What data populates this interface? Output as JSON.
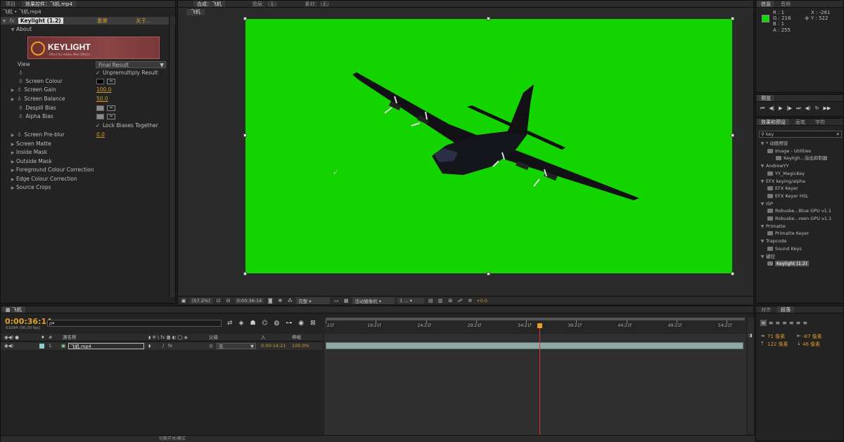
{
  "app": {
    "top_tabs": [
      "项目",
      "效果控件：飞机.mp4",
      "合成：飞机",
      "图层：（无）",
      "素材：（无）"
    ]
  },
  "effect_controls": {
    "breadcrumb": "飞机 • 飞机.mp4",
    "fx_label": "fx",
    "effect_name": "Keylight (1.2)",
    "reset": "重置",
    "about_link": "关于...",
    "about": "About",
    "logo_text": "KEYLIGHT",
    "logo_sub": "Effect for Adobe After Effects",
    "view_label": "View",
    "view_value": "Final Result",
    "unpremultiply": "Unpremultiply Result",
    "screen_colour": "Screen Colour",
    "screen_gain": "Screen Gain",
    "screen_gain_val": "100.0",
    "screen_balance": "Screen Balance",
    "screen_balance_val": "50.0",
    "despill_bias": "Despill Bias",
    "alpha_bias": "Alpha Bias",
    "lock_biases": "Lock Biases Together",
    "screen_preblur": "Screen Pre-blur",
    "screen_preblur_val": "0.0",
    "groups": [
      "Screen Matte",
      "Inside Mask",
      "Outside Mask",
      "Foreground Colour Correction",
      "Edge Colour Correction",
      "Source Crops"
    ]
  },
  "composition": {
    "tab": "飞机",
    "zoom": "(57.2%)",
    "timecode": "0:00:36:14",
    "quality": "完整",
    "camera": "活动摄像机",
    "views": "1 ...",
    "exposure": "+0.0"
  },
  "info": {
    "tabs": [
      "信息",
      "音频"
    ],
    "r": "R : 1",
    "g": "G : 216",
    "b": "B : 1",
    "a": "A : 255",
    "x": "X : -261",
    "y": "Y : 522",
    "swatch": "#12d801"
  },
  "preview": {
    "tab": "预览"
  },
  "effects_presets": {
    "tabs": [
      "效果和预设",
      "画笔",
      "字符"
    ],
    "search": "key",
    "items": [
      {
        "label": "* 动画预设",
        "level": 0,
        "type": "folder"
      },
      {
        "label": "Image - Utilities",
        "level": 1,
        "type": "folder"
      },
      {
        "label": "Keyligh...溢出抑制器",
        "level": 2,
        "type": "preset"
      },
      {
        "label": "AndrewYY",
        "level": 0,
        "type": "cat"
      },
      {
        "label": "YY_MagicKey",
        "level": 1,
        "type": "plugin"
      },
      {
        "label": "EFX keying/alpha",
        "level": 0,
        "type": "cat"
      },
      {
        "label": "EFX Keyer",
        "level": 1,
        "type": "plugin"
      },
      {
        "label": "EFX Keyer HSL",
        "level": 1,
        "type": "plugin"
      },
      {
        "label": "ISP",
        "level": 0,
        "type": "cat"
      },
      {
        "label": "Robuske...Blue GPU v1.1",
        "level": 1,
        "type": "plugin"
      },
      {
        "label": "Robuske...reen GPU v1.1",
        "level": 1,
        "type": "plugin"
      },
      {
        "label": "Primatte",
        "level": 0,
        "type": "cat"
      },
      {
        "label": "Primatte Keyer",
        "level": 1,
        "type": "plugin"
      },
      {
        "label": "Trapcode",
        "level": 0,
        "type": "cat"
      },
      {
        "label": "Sound Keys",
        "level": 1,
        "type": "plugin"
      },
      {
        "label": "键控",
        "level": 0,
        "type": "cat"
      },
      {
        "label": "Keylight (1.2)",
        "level": 1,
        "type": "plugin",
        "selected": true
      }
    ]
  },
  "paragraph": {
    "tabs": [
      "对齐",
      "段落"
    ],
    "v1": "71 像素",
    "v2": "-87 像素",
    "v3": "122 像素",
    "v4": "46 像素"
  },
  "timeline": {
    "tab": "飞机",
    "timecode": "0:00:36:14",
    "frames": "01094 (30.00 fps)",
    "search_placeholder": "ρ▾",
    "col_name": "源名称",
    "col_parent": "父级",
    "col_in": "入",
    "col_stretch": "伸缩",
    "layer": {
      "num": "1",
      "name": "飞机.mp4",
      "fx": "fx",
      "parent": "无",
      "in": "0:00:14:21",
      "stretch": "100.0%"
    },
    "ruler": [
      ":21f",
      "19:21f",
      "24:21f",
      "29:21f",
      "34:21f",
      "39:21f",
      "44:21f",
      "49:21f",
      "54:21f"
    ],
    "playhead_frac": 0.51,
    "bottom_label": "切换开关/模式"
  }
}
